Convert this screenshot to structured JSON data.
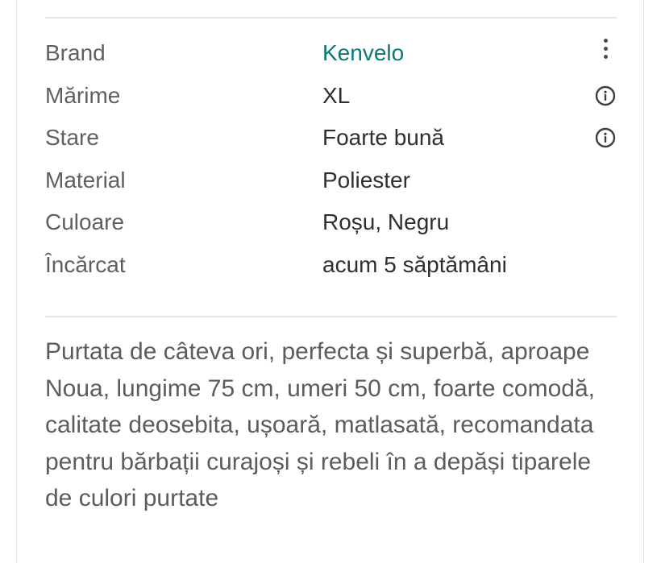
{
  "details": [
    {
      "label": "Brand",
      "value": "Kenvelo",
      "value_is_link": true,
      "action_icon": "more-vertical-icon"
    },
    {
      "label": "Mărime",
      "value": "XL",
      "value_is_link": false,
      "action_icon": "info-icon"
    },
    {
      "label": "Stare",
      "value": "Foarte bună",
      "value_is_link": false,
      "action_icon": "info-icon"
    },
    {
      "label": "Material",
      "value": "Poliester",
      "value_is_link": false,
      "action_icon": ""
    },
    {
      "label": "Culoare",
      "value": "Roșu, Negru",
      "value_is_link": false,
      "action_icon": ""
    },
    {
      "label": "Încărcat",
      "value": "acum 5 săptămâni",
      "value_is_link": false,
      "action_icon": ""
    }
  ],
  "description": "Purtata de câteva ori, perfecta și superbă, aproape Noua, lungime 75 cm, umeri 50 cm, foarte comodă, calitate deosebita, ușoară, matlasată, recomandata pentru bărbații curajoși și rebeli în a depăși tiparele de culori purtate",
  "colors": {
    "link": "#0b7a75",
    "label": "#5f5f5f",
    "value": "#2f2f2f",
    "description": "#5c5c5c",
    "divider": "#e6e6e6"
  }
}
